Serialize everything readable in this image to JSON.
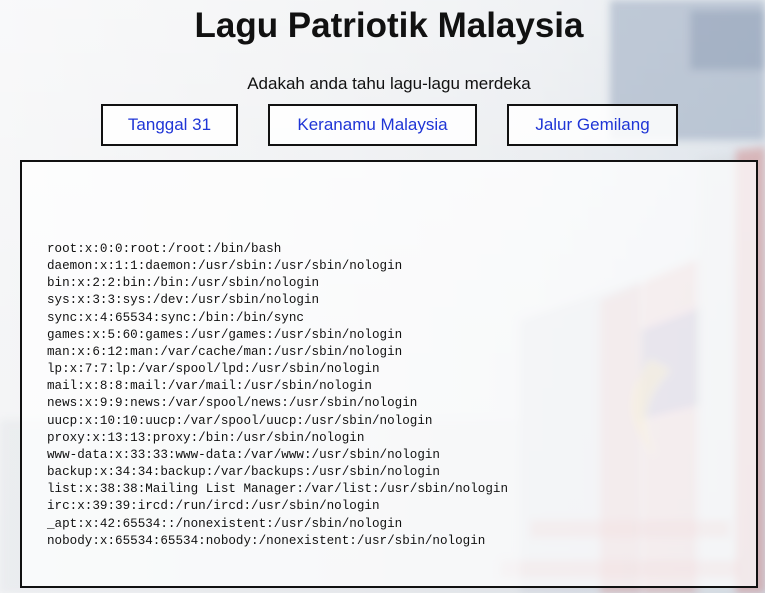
{
  "page": {
    "title": "Lagu Patriotik Malaysia",
    "subtitle": "Adakah anda tahu lagu-lagu merdeka"
  },
  "buttons": [
    {
      "label": "Tanggal 31"
    },
    {
      "label": "Keranamu Malaysia"
    },
    {
      "label": "Jalur Gemilang"
    }
  ],
  "output": {
    "lines": [
      "root:x:0:0:root:/root:/bin/bash",
      "daemon:x:1:1:daemon:/usr/sbin:/usr/sbin/nologin",
      "bin:x:2:2:bin:/bin:/usr/sbin/nologin",
      "sys:x:3:3:sys:/dev:/usr/sbin/nologin",
      "sync:x:4:65534:sync:/bin:/bin/sync",
      "games:x:5:60:games:/usr/games:/usr/sbin/nologin",
      "man:x:6:12:man:/var/cache/man:/usr/sbin/nologin",
      "lp:x:7:7:lp:/var/spool/lpd:/usr/sbin/nologin",
      "mail:x:8:8:mail:/var/mail:/usr/sbin/nologin",
      "news:x:9:9:news:/var/spool/news:/usr/sbin/nologin",
      "uucp:x:10:10:uucp:/var/spool/uucp:/usr/sbin/nologin",
      "proxy:x:13:13:proxy:/bin:/usr/sbin/nologin",
      "www-data:x:33:33:www-data:/var/www:/usr/sbin/nologin",
      "backup:x:34:34:backup:/var/backups:/usr/sbin/nologin",
      "list:x:38:38:Mailing List Manager:/var/list:/usr/sbin/nologin",
      "irc:x:39:39:ircd:/run/ircd:/usr/sbin/nologin",
      "_apt:x:42:65534::/nonexistent:/usr/sbin/nologin",
      "nobody:x:65534:65534:nobody:/nonexistent:/usr/sbin/nologin"
    ]
  },
  "colors": {
    "button_text": "#1f35d6",
    "border": "#111111",
    "flag_red": "#c8332f",
    "flag_blue": "#1d2d8c",
    "flag_yellow": "#f2c12e"
  },
  "icons": {
    "background": "malaysian-flag-background"
  }
}
